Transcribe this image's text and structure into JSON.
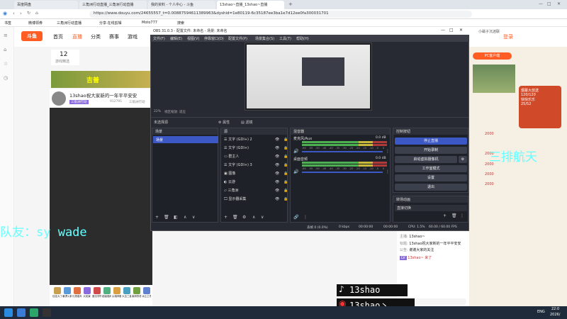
{
  "browser": {
    "tabs": [
      "百度网盘",
      "三角洲行动直播_三角洲行动直播",
      "我的资料 - 个人中心 - 斗鱼",
      "13shao~直播_13shao~直播"
    ],
    "url": "https://www.douyu.com/24655557_t=0.00887594611389963&dyshid=1e80119-6c35187ee3ba1e7d12ee0fa300031701",
    "bookmarks": [
      "书签",
      "微博领券",
      "三角洲行动直播",
      "分享·在线剪辑",
      "Moto777",
      "搜索"
    ]
  },
  "site": {
    "logo": "斗鱼",
    "nav": [
      "首页",
      "直播",
      "分类",
      "赛事",
      "游戏"
    ],
    "header_right": [
      "小磁子沉迷联",
      "登录"
    ],
    "counter": "12",
    "counter_label": "游戏精选",
    "banner": "吉普",
    "streamer_name": "13shao祝大家新的一年平平安安",
    "streamer_tag": "三角洲行动",
    "streamer_meta": [
      "912791",
      "三角洲行动"
    ],
    "gifts": [
      "佳佳大了",
      "暴漂火箭",
      "礼物嘉年",
      "大前景",
      "魔法学院",
      "超级福利",
      "尖端神器",
      "大吉三星",
      "森林物语",
      "冰云之境"
    ],
    "right_banner": "PC客户端",
    "right_promo": [
      "烟幕大放送",
      "120/120",
      "快快乐乐",
      "25/52"
    ],
    "right_badges": [
      "2000",
      "2000",
      "2000",
      "2000",
      "2000"
    ],
    "side_text": "三排航天",
    "chat": [
      {
        "user": "主播:",
        "text": "13shao~"
      },
      {
        "user": "标题:",
        "text": "13shao祝大家新的一年平平安安"
      },
      {
        "user": "公告:",
        "text": "谢谢大家的关注"
      },
      {
        "user": "",
        "text": "13shao~ 来了"
      }
    ],
    "social_1": "13shao",
    "social_2": "13shao丶"
  },
  "overlay": {
    "teammate": "队友：sy wade"
  },
  "obs": {
    "title": "OBS 31.0.3 - 配置文件: 未命名 - 场景: 未命名",
    "menu": [
      "文件(F)",
      "编辑(E)",
      "视图(V)",
      "停靠窗口(D)",
      "配置文件(P)",
      "场景集合(S)",
      "工具(T)",
      "帮助(H)"
    ],
    "zoom": "22%",
    "zoom_mode": "视区缩放: 适应",
    "no_source": "未选择源",
    "properties": "属性",
    "filters": "滤镜",
    "scenes_title": "场景",
    "scene_item": "场景",
    "sources_title": "源",
    "sources": [
      "文字 (GDI+) 2",
      "文字 (GDI+)",
      "群主人",
      "文字 (GDI+) 3",
      "图像",
      "云游",
      "三角洲",
      "显示器采集"
    ],
    "mixer_title": "混音器",
    "mixer": [
      {
        "name": "麦克风/Aux",
        "db": "0.0 dB"
      },
      {
        "name": "桌面音频",
        "db": "0.0 dB"
      }
    ],
    "mixer_scale": [
      "-60",
      "-55",
      "-50",
      "-45",
      "-40",
      "-35",
      "-30",
      "-25",
      "-20",
      "-15",
      "-10",
      "-5",
      "0"
    ],
    "controls_title": "控制按钮",
    "controls": [
      "停止直播",
      "开始录制",
      "启动虚拟摄像机",
      "工作室模式",
      "设置",
      "退出"
    ],
    "transitions_title": "转场动画",
    "transition": "直接切换",
    "status": {
      "dropped": "丢帧 0 (0.0%)",
      "kbps": "0 kbps",
      "live": "00:00:00",
      "rec": "00:00:00",
      "cpu": "CPU: 1.5%",
      "fps": "60.00 / 60.00 FPS"
    }
  },
  "taskbar": {
    "lang": "ENG",
    "time": "22:0",
    "date": "2026/"
  },
  "colors": {
    "accent": "#ff5d23",
    "obs_bg": "#272a33",
    "obs_selected": "#3c58c4",
    "overlay_cyan": "#66ffff"
  }
}
